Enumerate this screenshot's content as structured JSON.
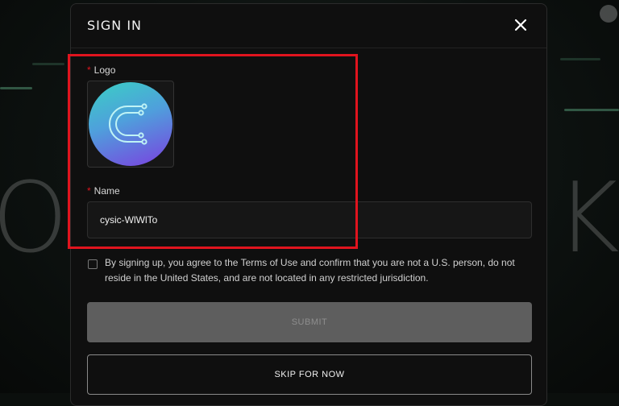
{
  "modal": {
    "title": "SIGN IN",
    "close_icon": "close-icon"
  },
  "form": {
    "logo": {
      "required_mark": "*",
      "label": "Logo",
      "image_icon": "cysic-logo-icon"
    },
    "name": {
      "required_mark": "*",
      "label": "Name",
      "value": "cysic-WlWlTo"
    },
    "terms": {
      "checked": false,
      "text": "By signing up, you agree to the Terms of Use and confirm that you are not a U.S. person, do not reside in the United States, and are not located in any restricted jurisdiction."
    },
    "submit_label": "SUBMIT",
    "skip_label": "SKIP FOR NOW"
  },
  "colors": {
    "highlight": "#e0141e",
    "required": "#e0141e",
    "logo_gradient": [
      "#3ad0c4",
      "#4f9fdc",
      "#7b3fe0"
    ]
  }
}
